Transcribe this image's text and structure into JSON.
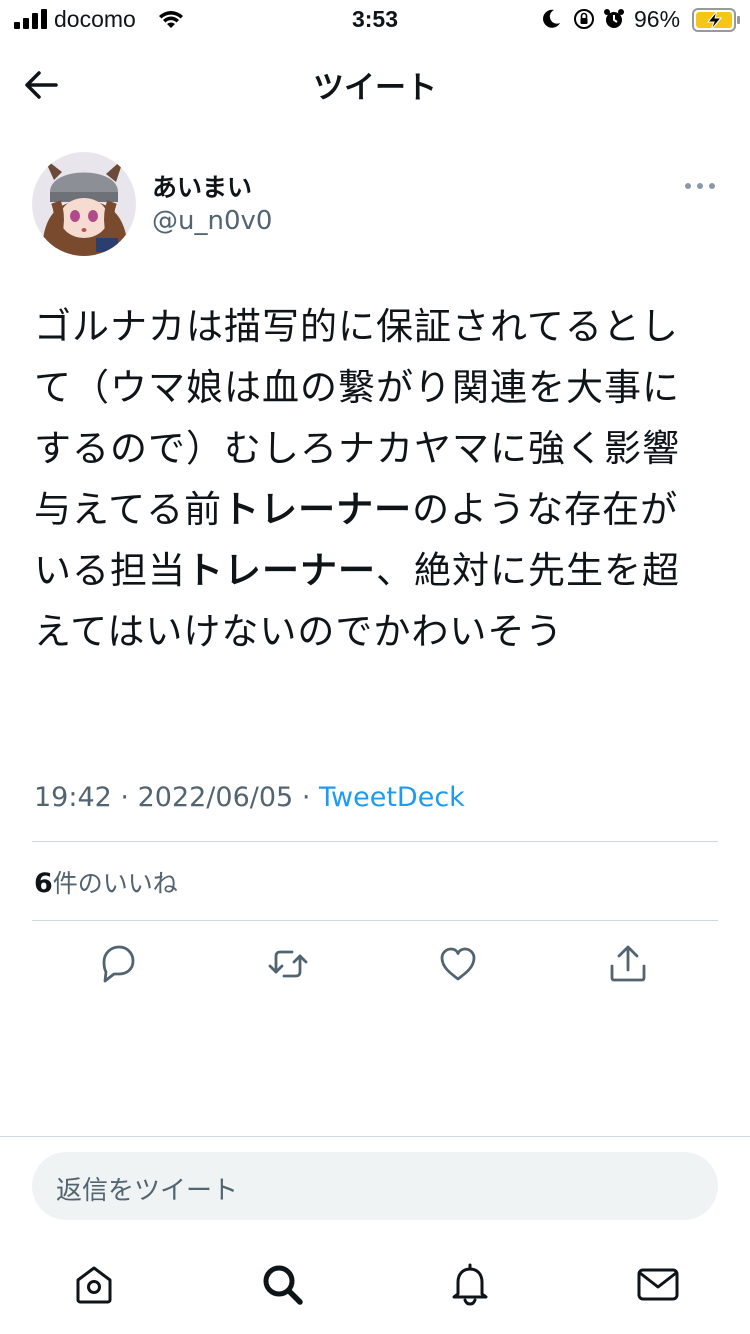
{
  "status_bar": {
    "carrier": "docomo",
    "time": "3:53",
    "battery_percent": "96%"
  },
  "header": {
    "title": "ツイート"
  },
  "tweet": {
    "author": {
      "display_name": "あいまい",
      "handle": "@u_n0v0"
    },
    "text_segments": [
      "ゴルナカは描写的に保証されてるとして（ウマ娘は血の繋がり関連を大事にするので）むしろナカヤマに強く影響与えてる前",
      "トレーナー",
      "のような存在がいる担当",
      "トレーナー",
      "、絶対に先生を超えてはいけないのでかわいそう"
    ],
    "time": "19:42",
    "date": "2022/06/05",
    "separator": "·",
    "source": "TweetDeck",
    "likes_count": "6",
    "likes_label": "件のいいね"
  },
  "reply": {
    "placeholder": "返信をツイート"
  },
  "colors": {
    "accent": "#1d9bf0",
    "text": "#0f1419",
    "secondary": "#536471",
    "divider": "#cfd9de"
  }
}
